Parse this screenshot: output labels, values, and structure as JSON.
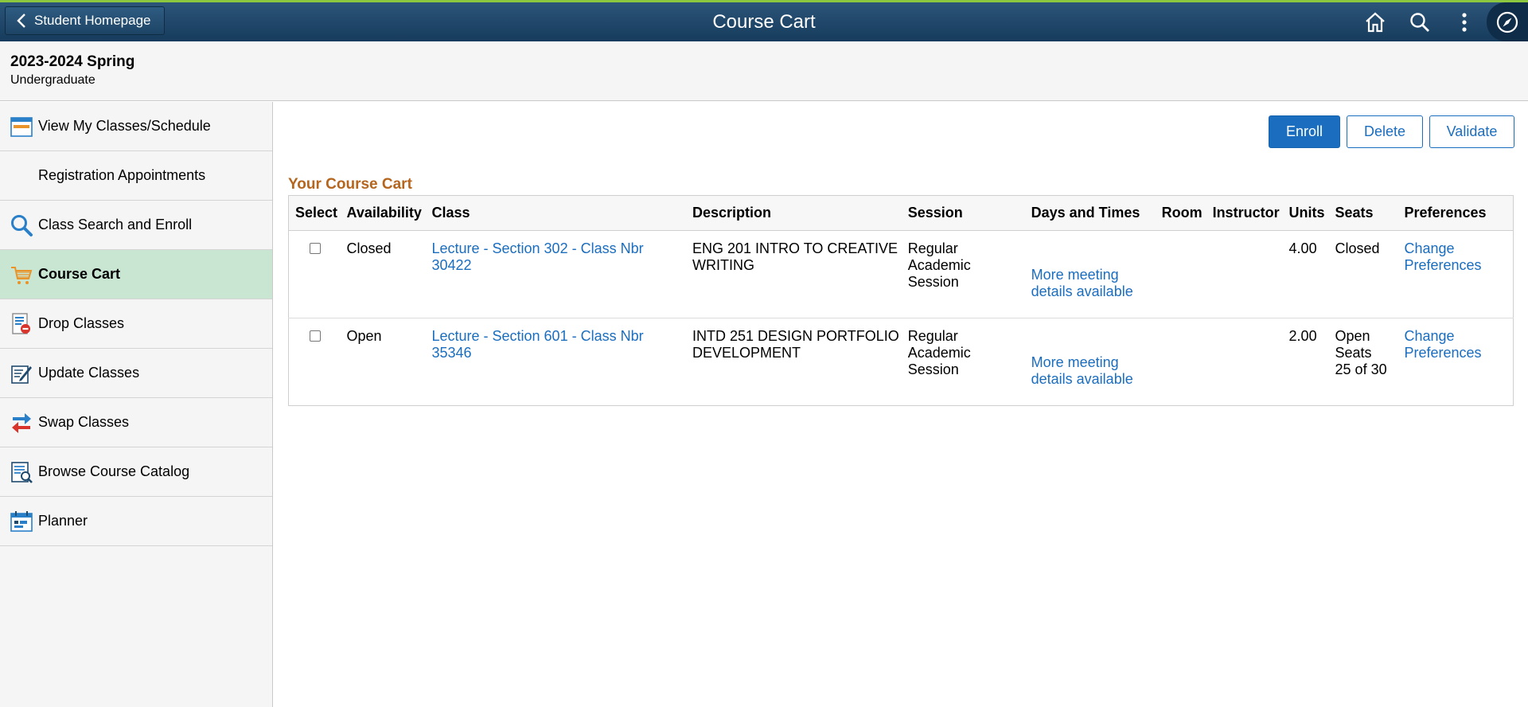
{
  "header": {
    "back_label": "Student Homepage",
    "title": "Course Cart"
  },
  "context": {
    "term": "2023-2024 Spring",
    "career": "Undergraduate"
  },
  "sidebar": {
    "items": [
      {
        "label": "View My Classes/Schedule",
        "icon": "calendar-icon"
      },
      {
        "label": "Registration Appointments",
        "icon": ""
      },
      {
        "label": "Class Search and Enroll",
        "icon": "search-icon"
      },
      {
        "label": "Course Cart",
        "icon": "cart-icon"
      },
      {
        "label": "Drop Classes",
        "icon": "drop-classes-icon"
      },
      {
        "label": "Update Classes",
        "icon": "update-classes-icon"
      },
      {
        "label": "Swap Classes",
        "icon": "swap-icon"
      },
      {
        "label": "Browse Course Catalog",
        "icon": "catalog-icon"
      },
      {
        "label": "Planner",
        "icon": "planner-icon"
      }
    ]
  },
  "actions": {
    "enroll": "Enroll",
    "delete": "Delete",
    "validate": "Validate"
  },
  "cart": {
    "title": "Your Course Cart",
    "columns": [
      "Select",
      "Availability",
      "Class",
      "Description",
      "Session",
      "Days and Times",
      "Room",
      "Instructor",
      "Units",
      "Seats",
      "Preferences"
    ],
    "rows": [
      {
        "availability": "Closed",
        "class": "Lecture - Section 302 - Class Nbr 30422",
        "description_1": "ENG 201 INTRO TO CREATIVE",
        "description_2": "WRITING",
        "session_1": "Regular",
        "session_2": "Academic",
        "session_3": "Session",
        "days_1": "More meeting",
        "days_2": "details available",
        "room": "",
        "instructor": "",
        "units": "4.00",
        "seats_1": "Closed",
        "seats_2": "",
        "seats_3": "",
        "pref_1": "Change",
        "pref_2": "Preferences"
      },
      {
        "availability": "Open",
        "class": "Lecture - Section 601 - Class Nbr 35346",
        "description_1": "INTD 251 DESIGN PORTFOLIO",
        "description_2": "DEVELOPMENT",
        "session_1": "Regular",
        "session_2": "Academic",
        "session_3": "Session",
        "days_1": "More meeting",
        "days_2": "details available",
        "room": "",
        "instructor": "",
        "units": "2.00",
        "seats_1": "Open",
        "seats_2": "Seats",
        "seats_3": "25 of 30",
        "pref_1": "Change",
        "pref_2": "Preferences"
      }
    ]
  },
  "colors": {
    "banner": "#1f4a6e",
    "accent_strip": "#8dc63f",
    "active_item": "#c8e6d2",
    "primary": "#1a6dbf",
    "section_title": "#b5651d"
  }
}
